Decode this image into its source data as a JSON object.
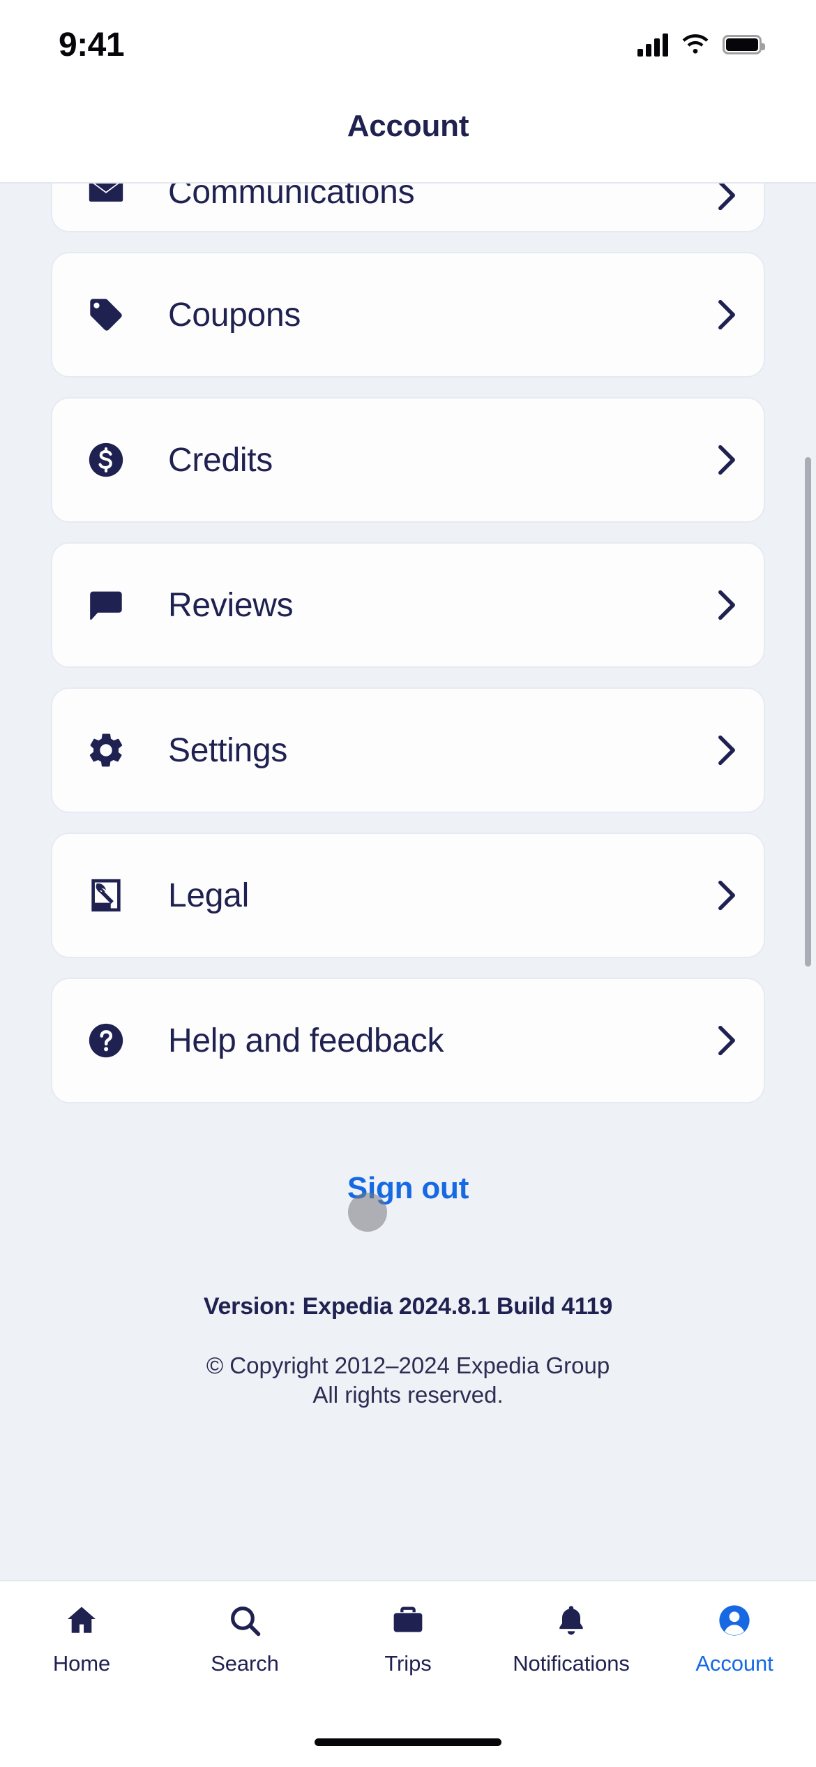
{
  "status_bar": {
    "time": "9:41",
    "icons": [
      "cellular-signal-icon",
      "wifi-icon",
      "battery-icon"
    ]
  },
  "header": {
    "title": "Account"
  },
  "menu": {
    "items": [
      {
        "label": "Communications",
        "icon": "envelope-icon",
        "chevron": "chevron-right-icon",
        "clipped": true
      },
      {
        "label": "Coupons",
        "icon": "tag-icon",
        "chevron": "chevron-right-icon"
      },
      {
        "label": "Credits",
        "icon": "dollar-circle-icon",
        "chevron": "chevron-right-icon"
      },
      {
        "label": "Reviews",
        "icon": "speech-bubble-icon",
        "chevron": "chevron-right-icon"
      },
      {
        "label": "Settings",
        "icon": "gear-icon",
        "chevron": "chevron-right-icon"
      },
      {
        "label": "Legal",
        "icon": "document-signature-icon",
        "chevron": "chevron-right-icon"
      },
      {
        "label": "Help and feedback",
        "icon": "question-circle-icon",
        "chevron": "chevron-right-icon"
      }
    ]
  },
  "sign_out": {
    "label": "Sign out"
  },
  "footer": {
    "version": "Version: Expedia 2024.8.1 Build 4119",
    "copyright_line1": "© Copyright 2012–2024 Expedia Group",
    "copyright_line2": "All rights reserved."
  },
  "tab_bar": {
    "items": [
      {
        "label": "Home",
        "icon": "home-icon",
        "active": false
      },
      {
        "label": "Search",
        "icon": "search-icon",
        "active": false
      },
      {
        "label": "Trips",
        "icon": "briefcase-icon",
        "active": false
      },
      {
        "label": "Notifications",
        "icon": "bell-icon",
        "active": false
      },
      {
        "label": "Account",
        "icon": "person-circle-icon",
        "active": true
      }
    ]
  },
  "colors": {
    "background": "#eef1f6",
    "card": "#fdfdfe",
    "ink": "#1f2150",
    "accent": "#1668e3"
  }
}
